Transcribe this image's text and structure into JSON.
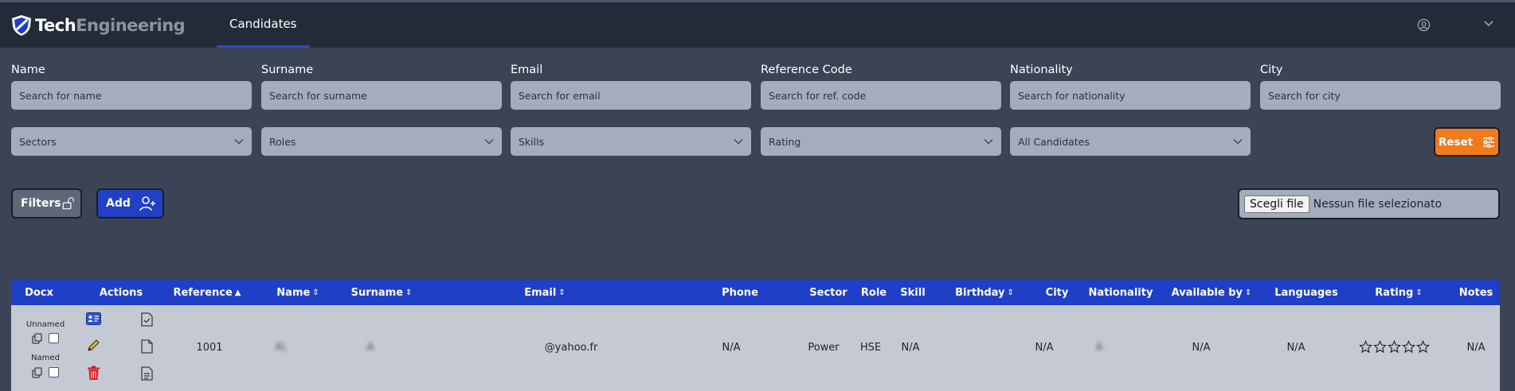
{
  "app": {
    "logo_part1": "Tech",
    "logo_part2": "Engineering",
    "nav_tab": "Candidates"
  },
  "filters": {
    "name": {
      "label": "Name",
      "placeholder": "Search for name"
    },
    "surname": {
      "label": "Surname",
      "placeholder": "Search for surname"
    },
    "email": {
      "label": "Email",
      "placeholder": "Search for email"
    },
    "reference": {
      "label": "Reference Code",
      "placeholder": "Search for ref. code"
    },
    "nationality": {
      "label": "Nationality",
      "placeholder": "Search for nationality"
    },
    "city": {
      "label": "City",
      "placeholder": "Search for city"
    },
    "selects": {
      "sectors": "Sectors",
      "roles": "Roles",
      "skills": "Skills",
      "rating": "Rating",
      "candidates": "All Candidates"
    },
    "reset_label": "Reset"
  },
  "toolbar": {
    "filters_label": "Filters",
    "add_label": "Add",
    "file_button": "Scegli file",
    "file_status": "Nessun file selezionato"
  },
  "table": {
    "headers": {
      "docx": "Docx",
      "actions": "Actions",
      "reference": "Reference",
      "name": "Name",
      "surname": "Surname",
      "email": "Email",
      "phone": "Phone",
      "sector": "Sector",
      "role": "Role",
      "skill": "Skill",
      "birthday": "Birthday",
      "city": "City",
      "nationality": "Nationality",
      "available_by": "Available by",
      "languages": "Languages",
      "rating": "Rating",
      "notes": "Notes"
    },
    "row": {
      "unnamed_label": "Unnamed",
      "named_label": "Named",
      "reference": "1001",
      "name": "A\\",
      "surname": "A",
      "email": "@yahoo.fr",
      "phone": "N/A",
      "sector": "Power",
      "role": "HSE",
      "skill": "N/A",
      "city": "N/A",
      "nationality": "A",
      "available_by": "N/A",
      "languages": "N/A",
      "rating_stars": 0,
      "notes": "N/A"
    }
  },
  "colors": {
    "header_bg": "#242b38",
    "page_bg": "#3a4455",
    "accent_blue": "#1f3fc6",
    "reset_orange": "#f07a1c"
  }
}
